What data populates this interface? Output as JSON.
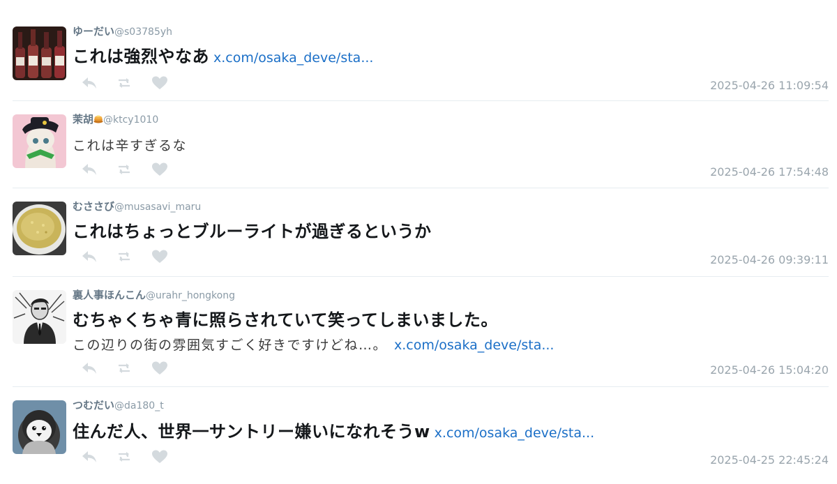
{
  "tweets": [
    {
      "name": "ゆーだい",
      "handle": "@s03785yh",
      "text": "これは強烈やなあ",
      "link": "x.com/osaka_deve/sta...",
      "timestamp": "2025-04-26 11:09:54",
      "avatar": "wine-bottles-avatar"
    },
    {
      "name": "茉胡",
      "name_emoji": "pancake-icon",
      "handle": "@ktcy1010",
      "text": "これは辛すぎるな",
      "timestamp": "2025-04-26 17:54:48",
      "avatar": "cartoon-cat-avatar"
    },
    {
      "name": "むささび",
      "handle": "@musasavi_maru",
      "text": "これはちょっとブルーライトが過ぎるというか",
      "timestamp": "2025-04-26 09:39:11",
      "avatar": "soup-bowl-avatar"
    },
    {
      "name": "裏人事ほんこん",
      "handle": "@urahr_hongkong",
      "text": "むちゃくちゃ青に照らされていて笑ってしまいました。",
      "text2": "この辺りの街の雰囲気すごく好きですけどね…。",
      "link": "x.com/osaka_deve/sta...",
      "timestamp": "2025-04-26 15:04:20",
      "avatar": "sketch-man-avatar"
    },
    {
      "name": "つむだい",
      "handle": "@da180_t",
      "text": "住んだ人、世界一サントリー嫌いになれそうw",
      "link": "x.com/osaka_deve/sta...",
      "timestamp": "2025-04-25 22:45:24",
      "avatar": "penguin-avatar"
    }
  ],
  "icons": {
    "reply": "reply-icon",
    "retweet": "retweet-icon",
    "like": "heart-icon"
  },
  "colors": {
    "link": "#1b6fc7",
    "name": "#657786",
    "icon": "#d4dade",
    "timestamp": "#9aa5ad",
    "divider": "#e6ecf0"
  }
}
